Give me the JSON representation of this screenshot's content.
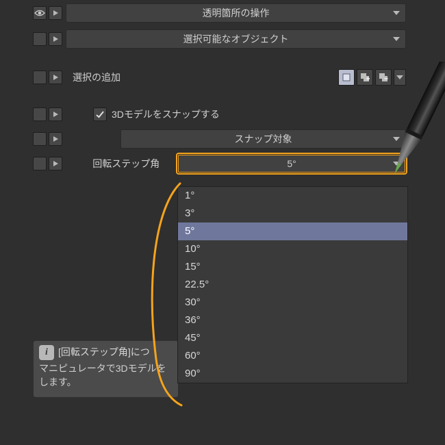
{
  "rows": {
    "transparent_ops": "透明箇所の操作",
    "selectable_objects": "選択可能なオブジェクト",
    "add_selection": "選択の追加",
    "snap_3d_model": "3Dモデルをスナップする",
    "snap_target": "スナップ対象",
    "rotation_step_label": "回転ステップ角",
    "rotation_step_value": "5°"
  },
  "rotation_step_options": [
    "1°",
    "3°",
    "5°",
    "10°",
    "15°",
    "22.5°",
    "30°",
    "36°",
    "45°",
    "60°",
    "90°"
  ],
  "rotation_step_selected_index": 2,
  "info": {
    "title_prefix": "[回転ステップ角]につ",
    "body": "マニピュレータで3Dモデルをします。"
  }
}
